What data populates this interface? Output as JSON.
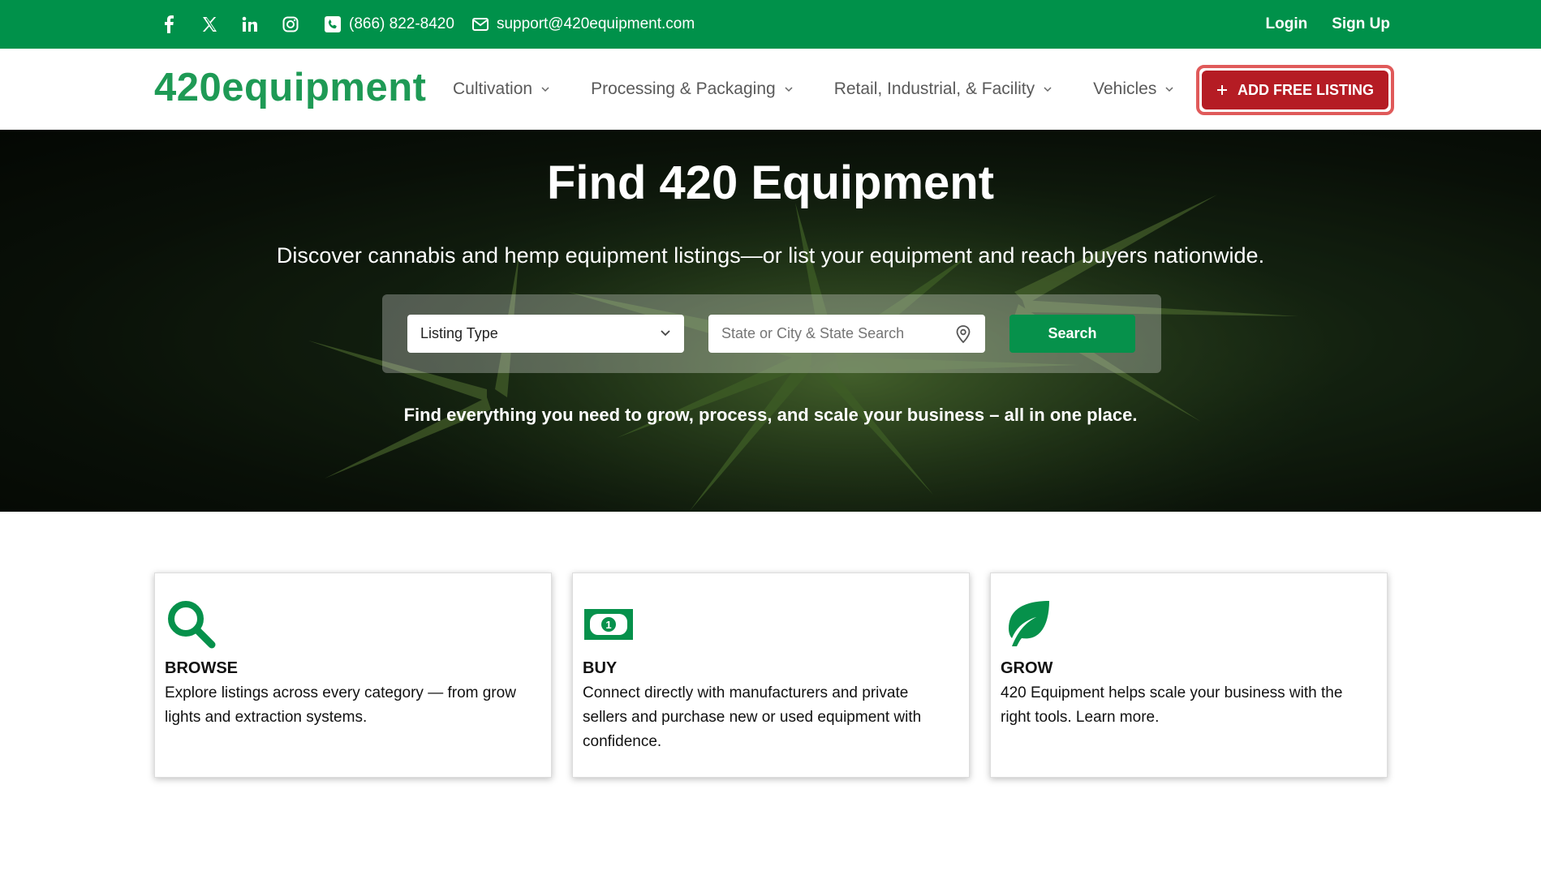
{
  "topbar": {
    "social": [
      "facebook-icon",
      "x-icon",
      "linkedin-icon",
      "instagram-icon"
    ],
    "phone": "(866) 822-8420",
    "email": "support@420equipment.com",
    "login": "Login",
    "signup": "Sign Up"
  },
  "nav": {
    "logo": "420equipment",
    "items": [
      {
        "label": "Cultivation"
      },
      {
        "label": "Processing & Packaging"
      },
      {
        "label": "Retail, Industrial, & Facility"
      },
      {
        "label": "Vehicles"
      }
    ],
    "cta": "ADD FREE LISTING"
  },
  "hero": {
    "title": "Find 420 Equipment",
    "subtitle": "Discover cannabis and hemp equipment listings—or list your equipment and reach buyers nationwide.",
    "listing_type": "Listing Type",
    "location_placeholder": "State or City & State Search",
    "search_label": "Search",
    "tagline": "Find everything you need to grow, process, and scale your business – all in one place."
  },
  "cards": [
    {
      "icon": "magnifier-icon",
      "title": "BROWSE",
      "text": "Explore listings across every category — from grow lights and extraction systems."
    },
    {
      "icon": "money-bill-icon",
      "title": "BUY",
      "text": "Connect directly with manufacturers and private sellers and purchase new or used equipment with confidence."
    },
    {
      "icon": "leaf-icon",
      "title": "GROW",
      "text": "420 Equipment helps scale your business with the right tools. Learn more."
    }
  ],
  "colors": {
    "brand_green": "#00914a",
    "cta_red": "#b51c24",
    "cta_border": "#e05a5a"
  }
}
